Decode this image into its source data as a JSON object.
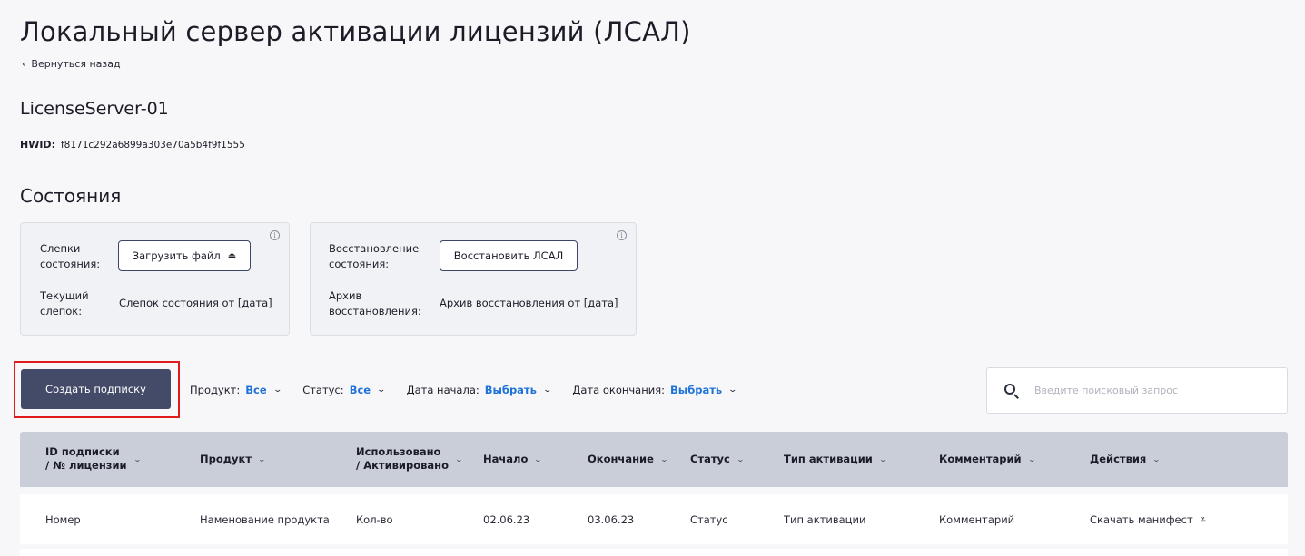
{
  "page": {
    "title": "Локальный сервер активации лицензий (ЛСАЛ)",
    "back_label": "Вернуться назад",
    "server_name": "LicenseServer-01",
    "hwid_label": "HWID:",
    "hwid_value": "f8171c292a6899a303e70a5b4f9f1555",
    "section_title": "Состояния"
  },
  "snapshots_card": {
    "row1_label_line1": "Слепки",
    "row1_label_line2": "состояния:",
    "upload_button": "Загрузить файл",
    "row2_label_line1": "Текущий",
    "row2_label_line2": "слепок:",
    "current_snapshot": "Слепок состояния от [дата]",
    "info_icon": "info-icon"
  },
  "restore_card": {
    "row1_label_line1": "Восстановление",
    "row1_label_line2": "состояния:",
    "restore_button": "Восстановить ЛСАЛ",
    "row2_label_line1": "Архив",
    "row2_label_line2": "восстановления:",
    "archive_value": "Архив восстановления от [дата]",
    "info_icon": "info-icon"
  },
  "toolbar": {
    "create_button": "Создать подписку",
    "filters": [
      {
        "label": "Продукт:",
        "value": "Все"
      },
      {
        "label": "Статус:",
        "value": "Все"
      },
      {
        "label": "Дата начала:",
        "value": "Выбрать"
      },
      {
        "label": "Дата окончания:",
        "value": "Выбрать"
      }
    ],
    "search_placeholder": "Введите поисковый запрос"
  },
  "table": {
    "headers": {
      "id_line1": "ID подписки",
      "id_line2": "/ № лицензии",
      "product": "Продукт",
      "used_line1": "Использовано",
      "used_line2": "/ Активировано",
      "start": "Начало",
      "end": "Окончание",
      "status": "Статус",
      "activation_type": "Тип активации",
      "comment": "Комментарий",
      "actions": "Действия"
    },
    "rows": [
      {
        "id": "Номер",
        "product": "Наменование продукта",
        "used": "Кол-во",
        "start": "02.06.23",
        "end": "03.06.23",
        "status": "Статус",
        "activation_type": "Тип активации",
        "comment": "Комментарий",
        "action": "Скачать манифест"
      }
    ]
  },
  "colors": {
    "accent_blue": "#1f73d8",
    "primary_button": "#434b68",
    "table_header_bg": "#c9ced9",
    "highlight_red": "#e01b1b"
  }
}
